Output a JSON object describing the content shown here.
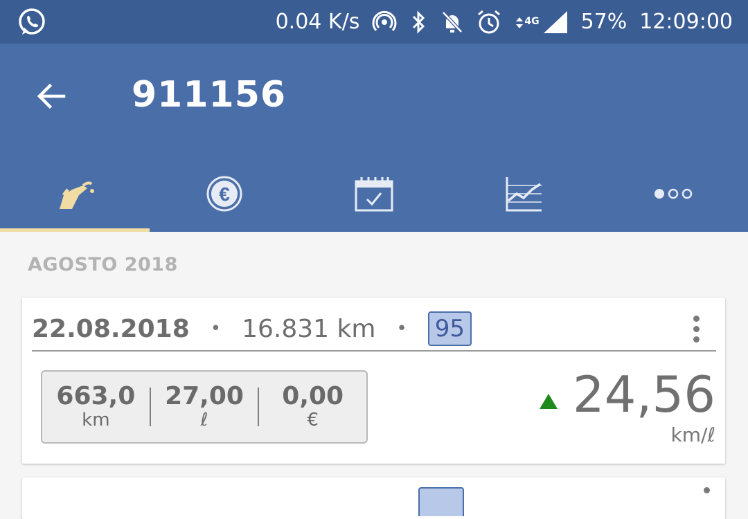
{
  "status_bar": {
    "net_speed": "0.04 K/s",
    "battery": "57%",
    "time": "12:09:00",
    "network_type": "4G",
    "icons": [
      "whatsapp-icon",
      "hotspot-icon",
      "bluetooth-icon",
      "bell-off-icon",
      "alarm-icon",
      "data-arrows-icon",
      "signal-icon"
    ]
  },
  "app_bar": {
    "title": "911156",
    "tabs": [
      {
        "icon": "fuel-pump-icon",
        "active": true
      },
      {
        "icon": "euro-icon",
        "active": false
      },
      {
        "icon": "calendar-check-icon",
        "active": false
      },
      {
        "icon": "line-chart-icon",
        "active": false
      },
      {
        "icon": "more-dots-icon",
        "active": false
      }
    ]
  },
  "section": {
    "header": "AGOSTO 2018"
  },
  "entry": {
    "date": "22.08.2018",
    "separator": "•",
    "odometer": "16.831 km",
    "fuel_type": "95",
    "stats": [
      {
        "value": "663,0",
        "unit": "km"
      },
      {
        "value": "27,00",
        "unit": "ℓ"
      },
      {
        "value": "0,00",
        "unit": "€"
      }
    ],
    "consumption": "24,56",
    "consumption_unit": "km/ℓ",
    "trend": "up"
  },
  "colors": {
    "status_bar": "#3a5d94",
    "app_bar": "#4a6fa8",
    "tab_indicator": "#f1dca4",
    "fuel_badge_bg": "#b8c8e8",
    "trend_up": "#1e8a1e"
  }
}
